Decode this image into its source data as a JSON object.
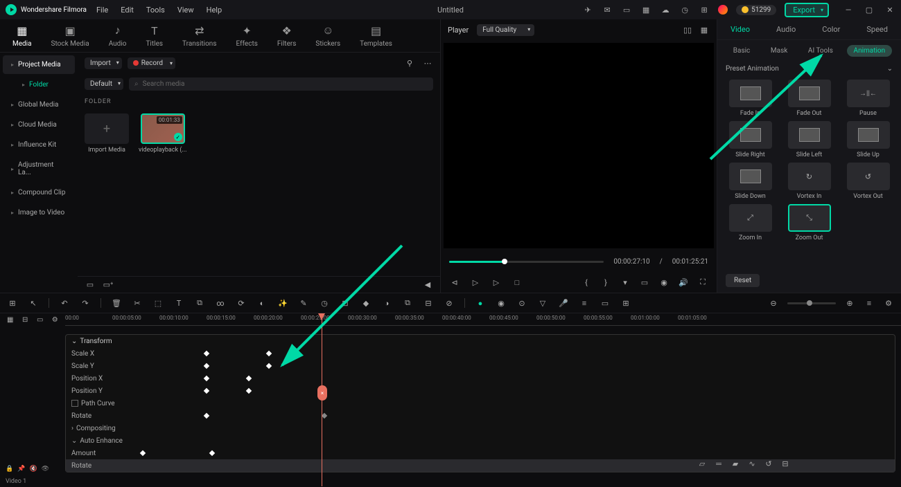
{
  "app": {
    "brand": "Wondershare Filmora",
    "title": "Untitled"
  },
  "menubar": [
    "File",
    "Edit",
    "Tools",
    "View",
    "Help"
  ],
  "credits": "51299",
  "export_label": "Export",
  "tool_tabs": [
    {
      "label": "Media",
      "icon": "▦"
    },
    {
      "label": "Stock Media",
      "icon": "▣"
    },
    {
      "label": "Audio",
      "icon": "♪"
    },
    {
      "label": "Titles",
      "icon": "T"
    },
    {
      "label": "Transitions",
      "icon": "⇄"
    },
    {
      "label": "Effects",
      "icon": "✦"
    },
    {
      "label": "Filters",
      "icon": "❖"
    },
    {
      "label": "Stickers",
      "icon": "☺"
    },
    {
      "label": "Templates",
      "icon": "▤"
    }
  ],
  "media_sidebar": [
    "Project Media",
    "Folder",
    "Global Media",
    "Cloud Media",
    "Influence Kit",
    "Adjustment La...",
    "Compound Clip",
    "Image to Video"
  ],
  "import_dd": "Import",
  "record_label": "Record",
  "default_dd": "Default",
  "search_placeholder": "Search media",
  "folder_label": "FOLDER",
  "import_tile_label": "Import Media",
  "clip": {
    "duration": "00:01:33",
    "name": "videoplayback (..."
  },
  "player": {
    "label": "Player",
    "quality": "Full Quality",
    "current": "00:00:27:10",
    "total": "00:01:25:21"
  },
  "rp_tabs": [
    "Video",
    "Audio",
    "Color",
    "Speed"
  ],
  "rp_subtabs": [
    "Basic",
    "Mask",
    "AI Tools",
    "Animation"
  ],
  "preset_header": "Preset Animation",
  "presets": [
    "Fade In",
    "Fade Out",
    "Pause",
    "Slide Right",
    "Slide Left",
    "Slide Up",
    "Slide Down",
    "Vortex In",
    "Vortex Out",
    "Zoom In",
    "Zoom Out"
  ],
  "reset_label": "Reset",
  "ruler_ticks": [
    "00:00",
    "00:00:05:00",
    "00:00:10:00",
    "00:00:15:00",
    "00:00:20:00",
    "00:00:25:00",
    "00:00:30:00",
    "00:00:35:00",
    "00:00:40:00",
    "00:00:45:00",
    "00:00:50:00",
    "00:00:55:00",
    "00:01:00:00",
    "00:01:05:00"
  ],
  "anim": {
    "transform": "Transform",
    "scale_x": "Scale X",
    "scale_y": "Scale Y",
    "pos_x": "Position X",
    "pos_y": "Position Y",
    "path_curve": "Path Curve",
    "rotate": "Rotate",
    "compositing": "Compositing",
    "auto_enhance": "Auto Enhance",
    "amount": "Amount",
    "rotate2": "Rotate"
  },
  "track": {
    "label": "Video 1"
  }
}
